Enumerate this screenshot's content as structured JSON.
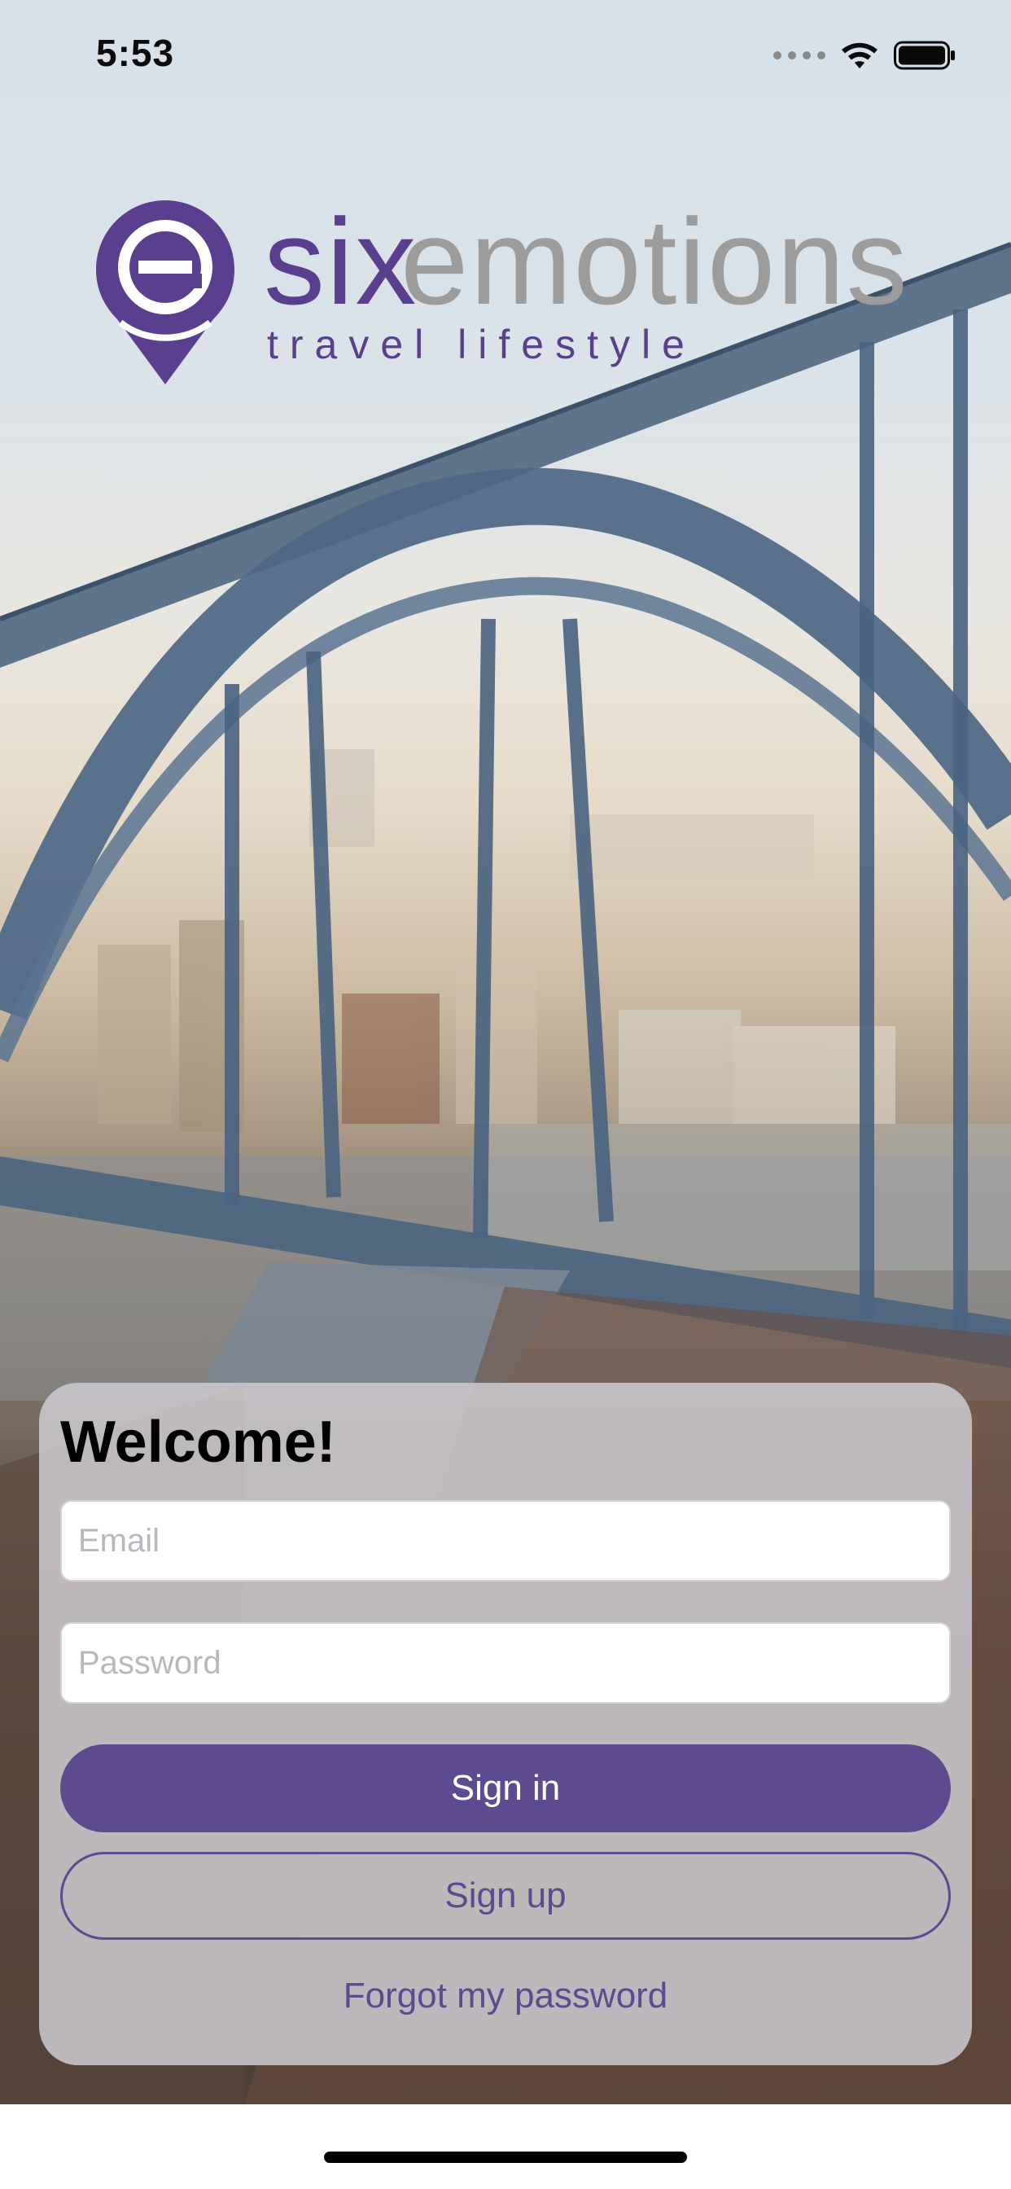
{
  "status_bar": {
    "time": "5:53",
    "icons": [
      "signal-icon",
      "wifi-icon",
      "battery-icon"
    ]
  },
  "logo": {
    "brand_part1": "six",
    "brand_part2": "emotions",
    "tagline": "travel lifestyle",
    "colors": {
      "primary": "#5b3f8f",
      "secondary": "#9c9c9c"
    }
  },
  "login": {
    "welcome": "Welcome!",
    "email": {
      "placeholder": "Email",
      "value": ""
    },
    "password": {
      "placeholder": "Password",
      "value": ""
    },
    "sign_in_label": "Sign in",
    "sign_up_label": "Sign up",
    "forgot_label": "Forgot my password"
  },
  "colors": {
    "accent": "#5d4a8f",
    "card_background": "#cdcbd0"
  }
}
